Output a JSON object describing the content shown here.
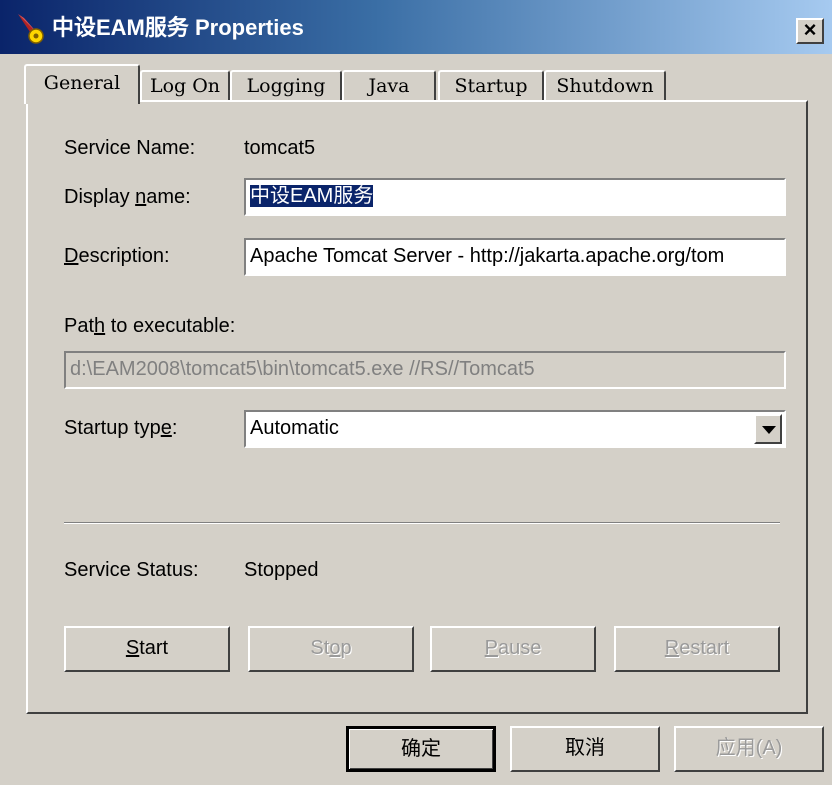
{
  "window": {
    "title": "中设EAM服务 Properties",
    "close_label": "×"
  },
  "tabs": [
    {
      "label": "General",
      "active": true
    },
    {
      "label": "Log On"
    },
    {
      "label": "Logging"
    },
    {
      "label": "Java"
    },
    {
      "label": "Startup"
    },
    {
      "label": "Shutdown"
    }
  ],
  "general": {
    "service_name_label": "Service Name:",
    "service_name_value": "tomcat5",
    "display_name_label_pre": "Display ",
    "display_name_label_key": "n",
    "display_name_label_post": "ame:",
    "display_name_value": "中设EAM服务",
    "description_label_key": "D",
    "description_label_post": "escription:",
    "description_value": "Apache Tomcat Server - http://jakarta.apache.org/tom",
    "path_label_pre": "Pat",
    "path_label_key": "h",
    "path_label_post": " to executable:",
    "path_value": "d:\\EAM2008\\tomcat5\\bin\\tomcat5.exe //RS//Tomcat5",
    "startup_type_label_pre": "Startup typ",
    "startup_type_label_key": "e",
    "startup_type_label_post": ":",
    "startup_type_value": "Automatic",
    "service_status_label": "Service Status:",
    "service_status_value": "Stopped"
  },
  "service_buttons": {
    "start_key": "S",
    "start_rest": "tart",
    "stop_pre": "St",
    "stop_key": "o",
    "stop_post": "p",
    "pause_key": "P",
    "pause_rest": "ause",
    "restart_key": "R",
    "restart_rest": "estart"
  },
  "dialog_buttons": {
    "ok": "确定",
    "cancel": "取消",
    "apply": "应用(A)"
  }
}
